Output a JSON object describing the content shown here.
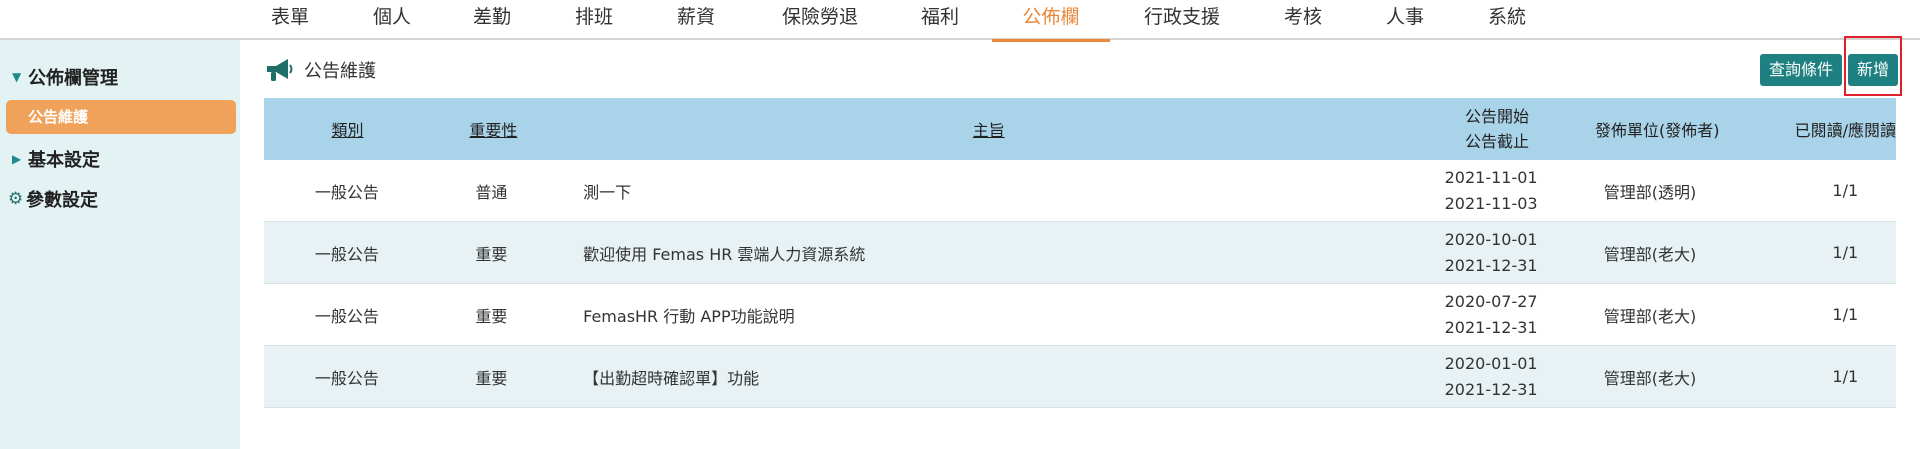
{
  "nav": {
    "tabs": [
      "表單",
      "個人",
      "差勤",
      "排班",
      "薪資",
      "保險勞退",
      "福利",
      "公佈欄",
      "行政支援",
      "考核",
      "人事",
      "系統"
    ],
    "active_index": 7
  },
  "sidebar": {
    "group1": "公佈欄管理",
    "active_item": "公告維護",
    "group2": "基本設定",
    "group3": "參數設定"
  },
  "page": {
    "title": "公告維護",
    "query_button": "查詢條件",
    "add_button": "新增"
  },
  "table": {
    "headers": {
      "category": "類別",
      "importance": "重要性",
      "subject": "主旨",
      "start": "公告開始",
      "end": "公告截止",
      "publisher": "發佈單位(發佈者)",
      "read": "已閱讀/應閱讀"
    },
    "rows": [
      {
        "category": "一般公告",
        "importance": "普通",
        "subject": "測一下",
        "start": "2021-11-01",
        "end": "2021-11-03",
        "publisher": "管理部(透明)",
        "read": "1/1"
      },
      {
        "category": "一般公告",
        "importance": "重要",
        "subject": "歡迎使用 Femas HR 雲端人力資源系統",
        "start": "2020-10-01",
        "end": "2021-12-31",
        "publisher": "管理部(老大)",
        "read": "1/1"
      },
      {
        "category": "一般公告",
        "importance": "重要",
        "subject": "FemasHR 行動 APP功能說明",
        "start": "2020-07-27",
        "end": "2021-12-31",
        "publisher": "管理部(老大)",
        "read": "1/1"
      },
      {
        "category": "一般公告",
        "importance": "重要",
        "subject": "【出勤超時確認單】功能",
        "start": "2020-01-01",
        "end": "2021-12-31",
        "publisher": "管理部(老大)",
        "read": "1/1"
      }
    ]
  },
  "colors": {
    "accent": "#e8883a",
    "button": "#1e8080",
    "sidebar_bg": "#e3f3f3",
    "header_bg": "#a9d3e8",
    "highlight": "#e0202a"
  }
}
